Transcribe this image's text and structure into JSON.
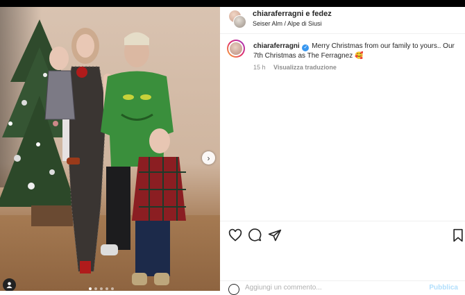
{
  "post": {
    "authors": "chiaraferragni e fedez",
    "location": "Seiser Alm / Alpe di Siusi",
    "caption_user": "chiaraferragni",
    "caption_text": "Merry Christmas from our family to yours.. Our 7th Christmas as The Ferragnez 🥰",
    "time_ago": "15 h",
    "translate_label": "Visualizza traduzione",
    "comment_placeholder": "Aggiungi un commento...",
    "publish_label": "Pubblica"
  },
  "carousel": {
    "slide_count": 5,
    "active_index": 0,
    "next_symbol": "›"
  },
  "icons": {
    "like": "heart-icon",
    "comment": "comment-icon",
    "share": "send-icon",
    "save": "bookmark-icon",
    "tag": "user-tag-icon"
  },
  "colors": {
    "verified": "#3897f0",
    "text": "#262626",
    "muted": "#8e8e8e"
  }
}
